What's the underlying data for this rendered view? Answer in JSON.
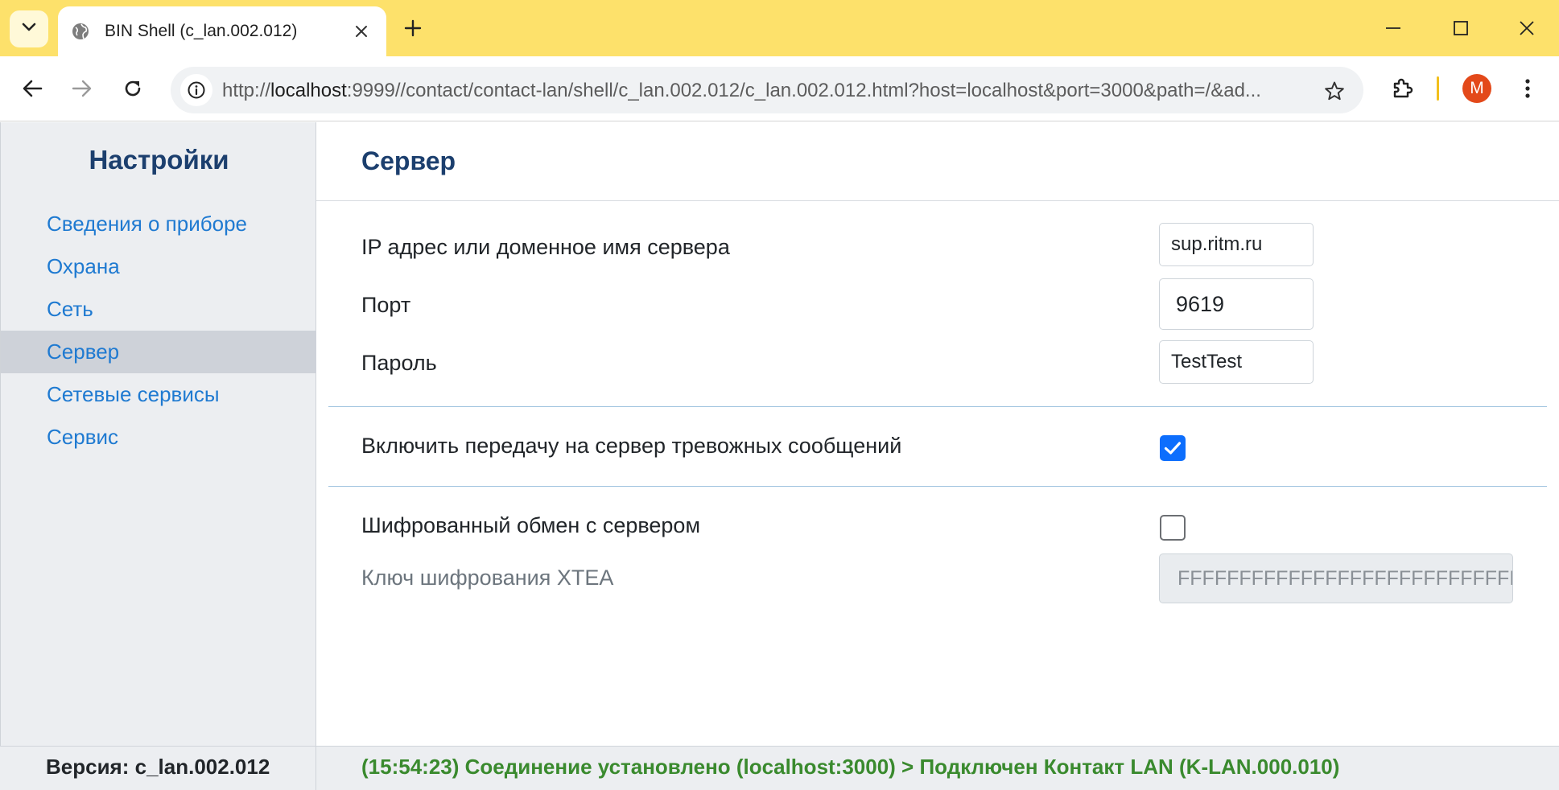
{
  "browser": {
    "tab_title": "BIN Shell (c_lan.002.012)",
    "url_prefix": "http://",
    "url_host": "localhost",
    "url_rest": ":9999//contact/contact-lan/shell/c_lan.002.012/c_lan.002.012.html?host=localhost&port=3000&path=/&ad...",
    "avatar_letter": "M",
    "avatar_color": "#e3491a",
    "titlebar_color": "#fde16b"
  },
  "sidebar": {
    "title": "Настройки",
    "items": [
      {
        "label": "Сведения о приборе"
      },
      {
        "label": "Охрана"
      },
      {
        "label": "Сеть"
      },
      {
        "label": "Сервер",
        "active": true
      },
      {
        "label": "Сетевые сервисы"
      },
      {
        "label": "Сервис"
      }
    ]
  },
  "main": {
    "title": "Сервер",
    "server_address_label": "IP адрес или доменное имя сервера",
    "server_address_value": "sup.ritm.ru",
    "port_label": "Порт",
    "port_value": "9619",
    "password_label": "Пароль",
    "password_value": "TestTest",
    "alarm_transfer_label": "Включить передачу на сервер тревожных сообщений",
    "alarm_transfer_checked": true,
    "encrypted_label": "Шифрованный обмен с сервером",
    "encrypted_checked": false,
    "xtea_label": "Ключ шифрования XTEA",
    "xtea_value": "FFFFFFFFFFFFFFFFFFFFFFFFFFFFFFFF"
  },
  "footer": {
    "version": "Версия: c_lan.002.012",
    "status": "(15:54:23) Соединение установлено (localhost:3000) > Подключен Контакт LAN (K-LAN.000.010)"
  }
}
